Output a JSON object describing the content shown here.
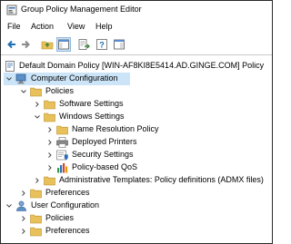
{
  "window": {
    "title": "Group Policy Management Editor"
  },
  "menu": [
    "File",
    "Action",
    "View",
    "Help"
  ],
  "tree": {
    "root": "Default Domain Policy [WIN-AF8KI8E5414.AD.GINGE.COM] Policy",
    "computer_configuration": "Computer Configuration",
    "policies": "Policies",
    "software_settings": "Software Settings",
    "windows_settings": "Windows Settings",
    "name_resolution_policy": "Name Resolution Policy",
    "deployed_printers": "Deployed Printers",
    "security_settings": "Security Settings",
    "policy_based_qos": "Policy-based QoS",
    "admin_templates": "Administrative Templates: Policy definitions (ADMX files)",
    "preferences": "Preferences",
    "user_configuration": "User Configuration",
    "user_policies": "Policies",
    "user_preferences": "Preferences"
  }
}
